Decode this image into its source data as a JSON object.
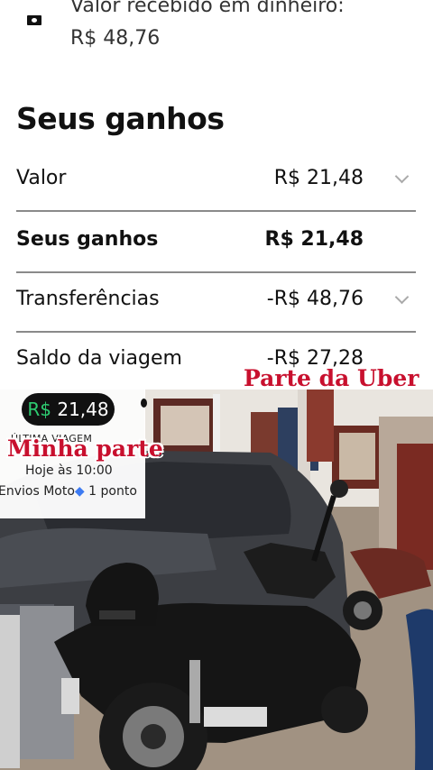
{
  "top": {
    "label": "Valor recebido em dinheiro:",
    "value": "R$ 48,76"
  },
  "section_title": "Seus ganhos",
  "rows": [
    {
      "label": "Valor",
      "value": "R$ 21,48",
      "expandable": true
    },
    {
      "label": "Seus ganhos",
      "value": "R$ 21,48",
      "expandable": false
    },
    {
      "label": "Transferências",
      "value": "-R$ 48,76",
      "expandable": true
    },
    {
      "label": "Saldo da viagem",
      "value": "-R$  27,28",
      "expandable": false
    }
  ],
  "overlay": {
    "uber_part": "Parte da Uber",
    "my_part": "Minha parte"
  },
  "trip_card": {
    "currency": "R$",
    "amount": "21,48",
    "last_trip_label": "ÚLTIMA VIAGEM",
    "time": "Hoje às 10:00",
    "service": "Envios Moto",
    "separator": "◆",
    "points": "1 ponto"
  },
  "colors": {
    "accent_green": "#2ecc71",
    "overlay_red": "#c8102e",
    "divider": "#8a8a8a"
  }
}
